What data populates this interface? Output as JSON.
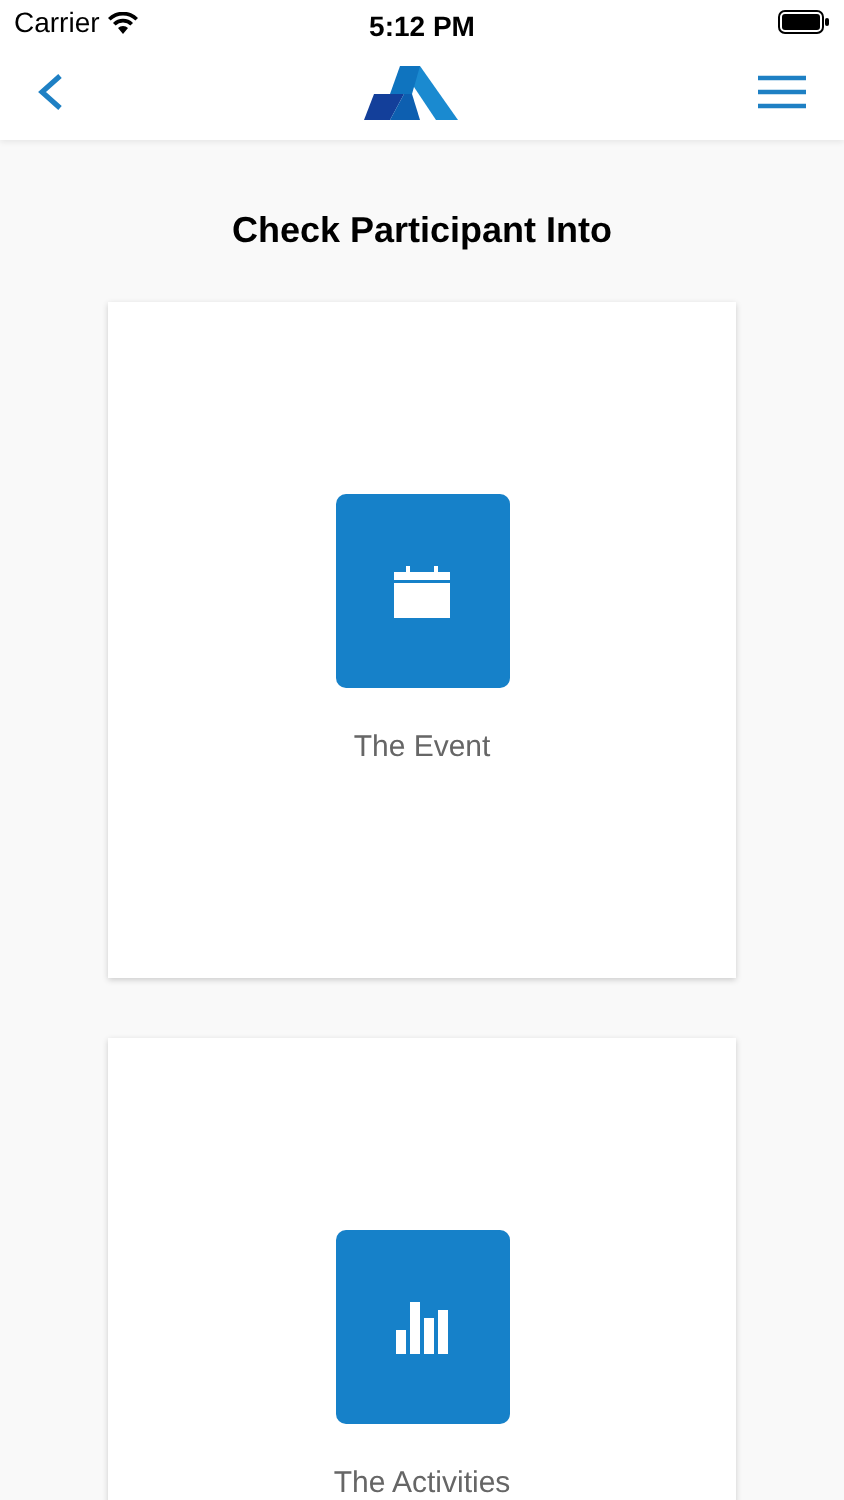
{
  "status_bar": {
    "carrier": "Carrier",
    "time": "5:12 PM"
  },
  "title": "Check Participant Into",
  "options": [
    {
      "kind": "calendar",
      "label": "The Event"
    },
    {
      "kind": "chart",
      "label": "The Activities"
    }
  ]
}
